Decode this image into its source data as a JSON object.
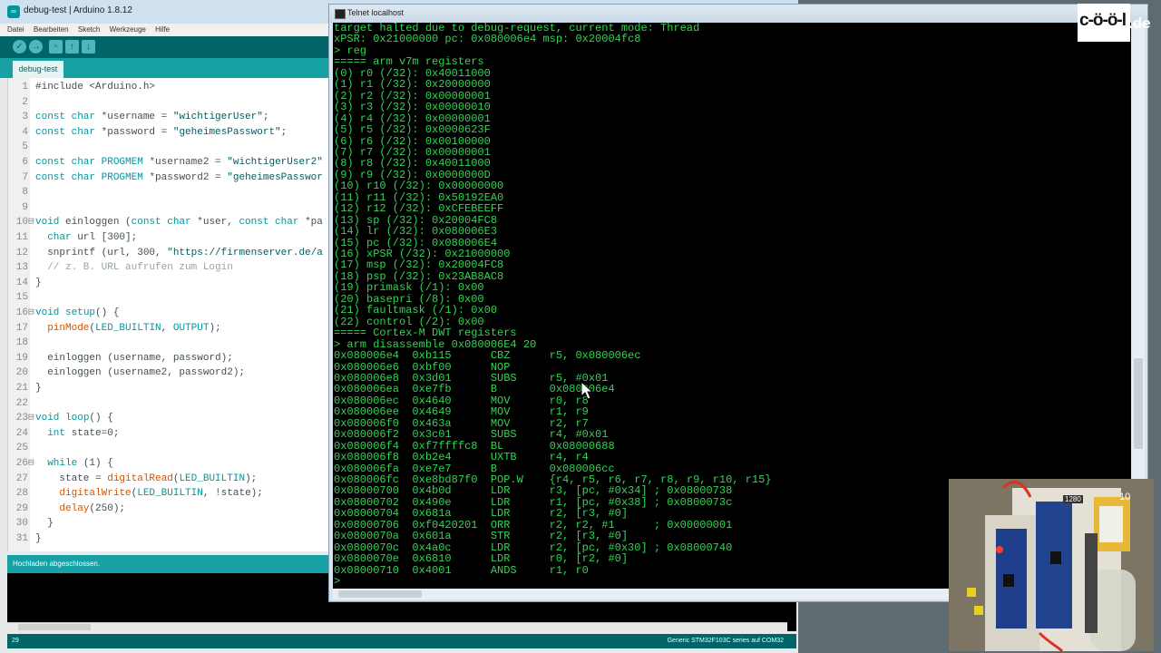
{
  "arduino": {
    "title": "debug-test | Arduino 1.8.12",
    "logo_text": "∞",
    "menu": [
      "Datei",
      "Bearbeiten",
      "Sketch",
      "Werkzeuge",
      "Hilfe"
    ],
    "tab": "debug-test",
    "code": [
      {
        "n": "1",
        "fold": "",
        "parts": [
          [
            "plain",
            "#include <Arduino.h>"
          ]
        ]
      },
      {
        "n": "2",
        "fold": "",
        "parts": []
      },
      {
        "n": "3",
        "fold": "",
        "parts": [
          [
            "kw",
            "const char"
          ],
          [
            "plain",
            " *username = "
          ],
          [
            "str",
            "\"wichtigerUser\""
          ],
          [
            "plain",
            ";"
          ]
        ]
      },
      {
        "n": "4",
        "fold": "",
        "parts": [
          [
            "kw",
            "const char"
          ],
          [
            "plain",
            " *password = "
          ],
          [
            "str",
            "\"geheimesPasswort\""
          ],
          [
            "plain",
            ";"
          ]
        ]
      },
      {
        "n": "5",
        "fold": "",
        "parts": []
      },
      {
        "n": "6",
        "fold": "",
        "parts": [
          [
            "kw",
            "const char"
          ],
          [
            "plain",
            " "
          ],
          [
            "kw",
            "PROGMEM"
          ],
          [
            "plain",
            " *username2 = "
          ],
          [
            "str",
            "\"wichtigerUser2\""
          ]
        ]
      },
      {
        "n": "7",
        "fold": "",
        "parts": [
          [
            "kw",
            "const char"
          ],
          [
            "plain",
            " "
          ],
          [
            "kw",
            "PROGMEM"
          ],
          [
            "plain",
            " *password2 = "
          ],
          [
            "str",
            "\"geheimesPasswor"
          ]
        ]
      },
      {
        "n": "8",
        "fold": "",
        "parts": []
      },
      {
        "n": "9",
        "fold": "",
        "parts": []
      },
      {
        "n": "10",
        "fold": "⊟",
        "parts": [
          [
            "kw",
            "void"
          ],
          [
            "plain",
            " einloggen ("
          ],
          [
            "kw",
            "const char"
          ],
          [
            "plain",
            " *user, "
          ],
          [
            "kw",
            "const char"
          ],
          [
            "plain",
            " *pa"
          ]
        ]
      },
      {
        "n": "11",
        "fold": "",
        "parts": [
          [
            "plain",
            "  "
          ],
          [
            "kw",
            "char"
          ],
          [
            "plain",
            " url [300];"
          ]
        ]
      },
      {
        "n": "12",
        "fold": "",
        "parts": [
          [
            "plain",
            "  snprintf (url, 300, "
          ],
          [
            "str",
            "\"https://firmenserver.de/a"
          ]
        ]
      },
      {
        "n": "13",
        "fold": "",
        "parts": [
          [
            "cm",
            "  // z. B. URL aufrufen zum Login"
          ]
        ]
      },
      {
        "n": "14",
        "fold": "",
        "parts": [
          [
            "plain",
            "}"
          ]
        ]
      },
      {
        "n": "15",
        "fold": "",
        "parts": []
      },
      {
        "n": "16",
        "fold": "⊟",
        "parts": [
          [
            "kw",
            "void"
          ],
          [
            "plain",
            " "
          ],
          [
            "kw",
            "setup"
          ],
          [
            "plain",
            "() {"
          ]
        ]
      },
      {
        "n": "17",
        "fold": "",
        "parts": [
          [
            "plain",
            "  "
          ],
          [
            "fn",
            "pinMode"
          ],
          [
            "plain",
            "("
          ],
          [
            "kw",
            "LED_BUILTIN"
          ],
          [
            "plain",
            ", "
          ],
          [
            "kw",
            "OUTPUT"
          ],
          [
            "plain",
            ");"
          ]
        ]
      },
      {
        "n": "18",
        "fold": "",
        "parts": []
      },
      {
        "n": "19",
        "fold": "",
        "parts": [
          [
            "plain",
            "  einloggen (username, password);"
          ]
        ]
      },
      {
        "n": "20",
        "fold": "",
        "parts": [
          [
            "plain",
            "  einloggen (username2, password2);"
          ]
        ]
      },
      {
        "n": "21",
        "fold": "",
        "parts": [
          [
            "plain",
            "}"
          ]
        ]
      },
      {
        "n": "22",
        "fold": "",
        "parts": []
      },
      {
        "n": "23",
        "fold": "⊟",
        "parts": [
          [
            "kw",
            "void"
          ],
          [
            "plain",
            " "
          ],
          [
            "kw",
            "loop"
          ],
          [
            "plain",
            "() {"
          ]
        ]
      },
      {
        "n": "24",
        "fold": "",
        "parts": [
          [
            "plain",
            "  "
          ],
          [
            "kw",
            "int"
          ],
          [
            "plain",
            " state=0;"
          ]
        ]
      },
      {
        "n": "25",
        "fold": "",
        "parts": []
      },
      {
        "n": "26",
        "fold": "⊟",
        "parts": [
          [
            "plain",
            "  "
          ],
          [
            "kw",
            "while"
          ],
          [
            "plain",
            " (1) {"
          ]
        ]
      },
      {
        "n": "27",
        "fold": "",
        "parts": [
          [
            "plain",
            "    state = "
          ],
          [
            "fn",
            "digitalRead"
          ],
          [
            "plain",
            "("
          ],
          [
            "kw",
            "LED_BUILTIN"
          ],
          [
            "plain",
            ");"
          ]
        ]
      },
      {
        "n": "28",
        "fold": "",
        "parts": [
          [
            "plain",
            "    "
          ],
          [
            "fn",
            "digitalWrite"
          ],
          [
            "plain",
            "("
          ],
          [
            "kw",
            "LED_BUILTIN"
          ],
          [
            "plain",
            ", !state);"
          ]
        ]
      },
      {
        "n": "29",
        "fold": "",
        "parts": [
          [
            "plain",
            "    "
          ],
          [
            "fn",
            "delay"
          ],
          [
            "plain",
            "(250);"
          ]
        ]
      },
      {
        "n": "30",
        "fold": "",
        "parts": [
          [
            "plain",
            "  }"
          ]
        ]
      },
      {
        "n": "31",
        "fold": "",
        "parts": [
          [
            "plain",
            "}"
          ]
        ]
      }
    ],
    "status": "Hochladen abgeschlossen.",
    "footer_left": "29",
    "footer_right": "Generic STM32F103C series auf COM32"
  },
  "telnet": {
    "title": "Telnet localhost",
    "lines": [
      "target halted due to debug-request, current mode: Thread",
      "xPSR: 0x21000000 pc: 0x080006e4 msp: 0x20004fc8",
      "> reg",
      "===== arm v7m registers",
      "(0) r0 (/32): 0x40011000",
      "(1) r1 (/32): 0x20000000",
      "(2) r2 (/32): 0x00000001",
      "(3) r3 (/32): 0x00000010",
      "(4) r4 (/32): 0x00000001",
      "(5) r5 (/32): 0x0000623F",
      "(6) r6 (/32): 0x00100000",
      "(7) r7 (/32): 0x00000001",
      "(8) r8 (/32): 0x40011000",
      "(9) r9 (/32): 0x0000000D",
      "(10) r10 (/32): 0x00000000",
      "(11) r11 (/32): 0x50192EA0",
      "(12) r12 (/32): 0xCFEBEEFF",
      "(13) sp (/32): 0x20004FC8",
      "(14) lr (/32): 0x080006E3",
      "(15) pc (/32): 0x080006E4",
      "(16) xPSR (/32): 0x21000000",
      "(17) msp (/32): 0x20004FC8",
      "(18) psp (/32): 0x23AB8AC8",
      "(19) primask (/1): 0x00",
      "(20) basepri (/8): 0x00",
      "(21) faultmask (/1): 0x00",
      "(22) control (/2): 0x00",
      "===== Cortex-M DWT registers",
      "> arm disassemble 0x080006E4 20",
      "0x080006e4  0xb115      CBZ      r5, 0x080006ec",
      "0x080006e6  0xbf00      NOP",
      "0x080006e8  0x3d01      SUBS     r5, #0x01",
      "0x080006ea  0xe7fb      B        0x080006e4",
      "0x080006ec  0x4640      MOV      r0, r8",
      "0x080006ee  0x4649      MOV      r1, r9",
      "0x080006f0  0x463a      MOV      r2, r7",
      "0x080006f2  0x3c01      SUBS     r4, #0x01",
      "0x080006f4  0xf7ffffc8  BL       0x08000688",
      "0x080006f8  0xb2e4      UXTB     r4, r4",
      "0x080006fa  0xe7e7      B        0x080006cc",
      "0x080006fc  0xe8bd87f0  POP.W    {r4, r5, r6, r7, r8, r9, r10, r15}",
      "0x08000700  0x4b0d      LDR      r3, [pc, #0x34] ; 0x08000738",
      "0x08000702  0x490e      LDR      r1, [pc, #0x38] ; 0x0800073c",
      "0x08000704  0x681a      LDR      r2, [r3, #0]",
      "0x08000706  0xf0420201  ORR      r2, r2, #1      ; 0x00000001",
      "0x0800070a  0x601a      STR      r2, [r3, #0]",
      "0x0800070c  0x4a0c      LDR      r2, [pc, #0x30] ; 0x08000740",
      "0x0800070e  0x6810      LDR      r0, [r2, #0]",
      "0x08000710  0x4001      ANDS     r1, r0",
      ">"
    ]
  },
  "logo": {
    "word": "c-ö-ö-l",
    "suffix": ".de"
  },
  "cam": {
    "badge": "1280",
    "count": "10"
  }
}
